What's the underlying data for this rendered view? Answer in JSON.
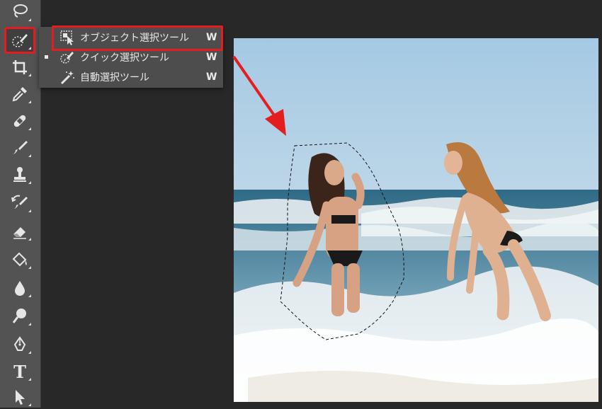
{
  "toolbar": {
    "tools": [
      {
        "name": "lasso-tool",
        "icon": "lasso-icon"
      },
      {
        "name": "object-selection-tool",
        "icon": "quick-selection-brush-icon",
        "active": true
      },
      {
        "name": "crop-tool",
        "icon": "crop-icon"
      },
      {
        "name": "eyedropper-tool",
        "icon": "eyedropper-icon"
      },
      {
        "name": "healing-brush-tool",
        "icon": "bandage-icon"
      },
      {
        "name": "brush-tool",
        "icon": "brush-icon"
      },
      {
        "name": "clone-stamp-tool",
        "icon": "stamp-icon"
      },
      {
        "name": "history-brush-tool",
        "icon": "history-brush-icon"
      },
      {
        "name": "eraser-tool",
        "icon": "eraser-icon"
      },
      {
        "name": "paint-bucket-tool",
        "icon": "paint-bucket-icon"
      },
      {
        "name": "blur-tool",
        "icon": "droplet-icon"
      },
      {
        "name": "dodge-tool",
        "icon": "dodge-icon"
      },
      {
        "name": "pen-tool",
        "icon": "pen-nib-icon"
      },
      {
        "name": "type-tool",
        "icon": "type-icon",
        "letter": "T"
      },
      {
        "name": "path-selection-tool",
        "icon": "arrow-cursor-icon"
      }
    ]
  },
  "flyout": {
    "items": [
      {
        "label": "オブジェクト選択ツール",
        "shortcut": "W",
        "icon": "object-selection-icon",
        "highlighted": true
      },
      {
        "label": "クイック選択ツール",
        "shortcut": "W",
        "icon": "quick-selection-icon",
        "checked": true
      },
      {
        "label": "自動選択ツール",
        "shortcut": "W",
        "icon": "magic-wand-icon"
      }
    ]
  },
  "colors": {
    "accent_red": "#e41e1e",
    "toolbar_bg": "#535353",
    "workspace_bg": "#282828",
    "menu_bg": "#4d4d4d"
  }
}
